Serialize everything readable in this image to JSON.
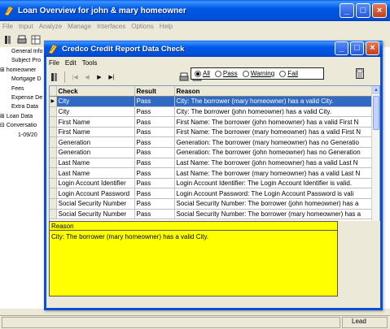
{
  "parent": {
    "title": "Loan Overview for john & mary homeowner",
    "menu": [
      "File",
      "Input",
      "Analyze",
      "Manage",
      "Interfaces",
      "Options",
      "Help"
    ],
    "tree": [
      "General Info",
      "Subject Pro",
      "homeowner",
      "Mortgage D",
      "Fees",
      "Expense De",
      "Extra Data",
      "Loan Data",
      "Conversatio",
      "1-09/20"
    ],
    "status": "Lead"
  },
  "child": {
    "title": "Credco Credit Report Data Check",
    "menu": [
      "File",
      "Edit",
      "Tools"
    ],
    "filter": {
      "all": "All",
      "pass": "Pass",
      "warning": "Warning",
      "fail": "Fail",
      "selected": "All"
    },
    "grid": {
      "columns": [
        "Check",
        "Result",
        "Reason"
      ],
      "rows": [
        {
          "check": "City",
          "result": "Pass",
          "reason": "City: The borrower (mary homeowner) has a valid City."
        },
        {
          "check": "City",
          "result": "Pass",
          "reason": "City: The borrower (john homeowner) has a valid City."
        },
        {
          "check": "First Name",
          "result": "Pass",
          "reason": "First Name: The borrower (john homeowner) has a valid First N"
        },
        {
          "check": "First Name",
          "result": "Pass",
          "reason": "First Name: The borrower (mary homeowner) has a valid First N"
        },
        {
          "check": "Generation",
          "result": "Pass",
          "reason": "Generation: The borrower (mary homeowner) has no Generatio"
        },
        {
          "check": "Generation",
          "result": "Pass",
          "reason": "Generation: The borrower (john homeowner) has no Generation"
        },
        {
          "check": "Last Name",
          "result": "Pass",
          "reason": "Last Name: The borrower (john homeowner) has a valid Last N"
        },
        {
          "check": "Last Name",
          "result": "Pass",
          "reason": "Last Name: The borrower (mary homeowner) has a valid Last N"
        },
        {
          "check": "Login Account Identifier",
          "result": "Pass",
          "reason": "Login Account Identifier: The Login Account Identifier is valid."
        },
        {
          "check": "Login Account Password",
          "result": "Pass",
          "reason": "Login Account Password: The Login Account Password is vali"
        },
        {
          "check": "Social Security Number",
          "result": "Pass",
          "reason": "Social Security Number: The borrower (john homeowner) has a"
        },
        {
          "check": "Social Security Number",
          "result": "Pass",
          "reason": "Social Security Number: The borrower (mary homeowner) has a"
        }
      ]
    },
    "reason_panel": {
      "header": "Reason",
      "text": "City: The borrower (mary homeowner) has a valid City."
    }
  },
  "colors": {
    "title_bar": "#0054e3",
    "selection": "#316ac5",
    "reason_bg": "#ffff00",
    "window_bg": "#ece9d8"
  }
}
